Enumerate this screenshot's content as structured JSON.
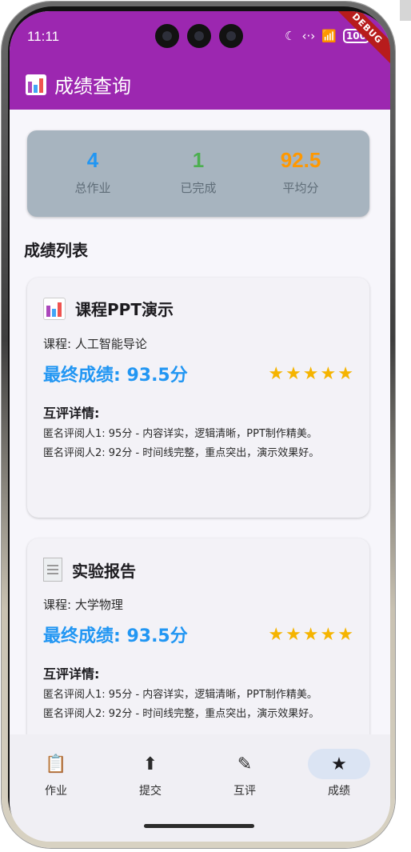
{
  "status_bar": {
    "time": "11:11",
    "battery": "100",
    "debug_label": "DEBUG"
  },
  "appbar": {
    "title": "成绩查询",
    "icon": "bar-chart-icon"
  },
  "summary": {
    "total": {
      "value": "4",
      "label": "总作业",
      "color": "#2196f3"
    },
    "done": {
      "value": "1",
      "label": "已完成",
      "color": "#4caf50"
    },
    "average": {
      "value": "92.5",
      "label": "平均分",
      "color": "#ff9800"
    }
  },
  "list_title": "成绩列表",
  "cards": [
    {
      "icon": "bar-chart-icon",
      "title": "课程PPT演示",
      "course": "课程: 人工智能导论",
      "score": "最终成绩: 93.5分",
      "stars": 5,
      "review_heading": "互评详情:",
      "reviews": [
        "匿名评阅人1: 95分 - 内容详实，逻辑清晰，PPT制作精美。",
        "匿名评阅人2: 92分 - 时间线完整，重点突出，演示效果好。"
      ]
    },
    {
      "icon": "document-icon",
      "title": "实验报告",
      "course": "课程: 大学物理",
      "score": "最终成绩: 93.5分",
      "stars": 5,
      "review_heading": "互评详情:",
      "reviews": [
        "匿名评阅人1: 95分 - 内容详实，逻辑清晰，PPT制作精美。",
        "匿名评阅人2: 92分 - 时间线完整，重点突出，演示效果好。"
      ]
    }
  ],
  "nav": [
    {
      "label": "作业",
      "icon": "assignment-icon",
      "glyph": "📋",
      "active": false
    },
    {
      "label": "提交",
      "icon": "upload-file-icon",
      "glyph": "⬆",
      "active": false
    },
    {
      "label": "互评",
      "icon": "rate-review-icon",
      "glyph": "✎",
      "active": false
    },
    {
      "label": "成绩",
      "icon": "star-icon",
      "glyph": "★",
      "active": true
    }
  ],
  "colors": {
    "appbar": "#9c27b0",
    "accent_blue": "#2196f3",
    "star": "#f5b400",
    "nav_active_pill": "#dbe4f3"
  }
}
